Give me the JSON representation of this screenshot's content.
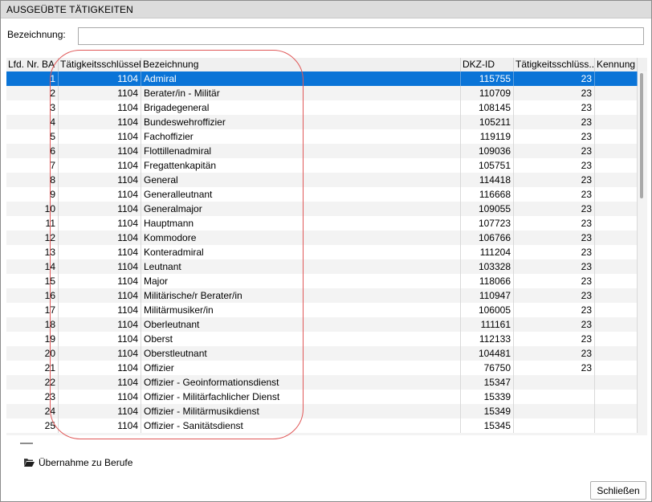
{
  "window": {
    "title": "AUSGEÜBTE TÄTIGKEITEN"
  },
  "filter": {
    "label": "Bezeichnung:",
    "value": "",
    "placeholder": ""
  },
  "table": {
    "columns": [
      "Lfd. Nr. BA",
      "Tätigkeitsschlüssel",
      "Bezeichnung",
      "DKZ-ID",
      "Tätigkeitsschlüss...",
      "Kennung"
    ],
    "selected_row": 0,
    "rows": [
      {
        "nr": "1",
        "key": "1104",
        "name": "Admiral",
        "dkz": "115755",
        "key2": "23",
        "id": ""
      },
      {
        "nr": "2",
        "key": "1104",
        "name": "Berater/in - Militär",
        "dkz": "110709",
        "key2": "23",
        "id": ""
      },
      {
        "nr": "3",
        "key": "1104",
        "name": "Brigadegeneral",
        "dkz": "108145",
        "key2": "23",
        "id": ""
      },
      {
        "nr": "4",
        "key": "1104",
        "name": "Bundeswehroffizier",
        "dkz": "105211",
        "key2": "23",
        "id": ""
      },
      {
        "nr": "5",
        "key": "1104",
        "name": "Fachoffizier",
        "dkz": "119119",
        "key2": "23",
        "id": ""
      },
      {
        "nr": "6",
        "key": "1104",
        "name": "Flottillenadmiral",
        "dkz": "109036",
        "key2": "23",
        "id": ""
      },
      {
        "nr": "7",
        "key": "1104",
        "name": "Fregattenkapitän",
        "dkz": "105751",
        "key2": "23",
        "id": ""
      },
      {
        "nr": "8",
        "key": "1104",
        "name": "General",
        "dkz": "114418",
        "key2": "23",
        "id": ""
      },
      {
        "nr": "9",
        "key": "1104",
        "name": "Generalleutnant",
        "dkz": "116668",
        "key2": "23",
        "id": ""
      },
      {
        "nr": "10",
        "key": "1104",
        "name": "Generalmajor",
        "dkz": "109055",
        "key2": "23",
        "id": ""
      },
      {
        "nr": "11",
        "key": "1104",
        "name": "Hauptmann",
        "dkz": "107723",
        "key2": "23",
        "id": ""
      },
      {
        "nr": "12",
        "key": "1104",
        "name": "Kommodore",
        "dkz": "106766",
        "key2": "23",
        "id": ""
      },
      {
        "nr": "13",
        "key": "1104",
        "name": "Konteradmiral",
        "dkz": "111204",
        "key2": "23",
        "id": ""
      },
      {
        "nr": "14",
        "key": "1104",
        "name": "Leutnant",
        "dkz": "103328",
        "key2": "23",
        "id": ""
      },
      {
        "nr": "15",
        "key": "1104",
        "name": "Major",
        "dkz": "118066",
        "key2": "23",
        "id": ""
      },
      {
        "nr": "16",
        "key": "1104",
        "name": "Militärische/r Berater/in",
        "dkz": "110947",
        "key2": "23",
        "id": ""
      },
      {
        "nr": "17",
        "key": "1104",
        "name": "Militärmusiker/in",
        "dkz": "106005",
        "key2": "23",
        "id": ""
      },
      {
        "nr": "18",
        "key": "1104",
        "name": "Oberleutnant",
        "dkz": "111161",
        "key2": "23",
        "id": ""
      },
      {
        "nr": "19",
        "key": "1104",
        "name": "Oberst",
        "dkz": "112133",
        "key2": "23",
        "id": ""
      },
      {
        "nr": "20",
        "key": "1104",
        "name": "Oberstleutnant",
        "dkz": "104481",
        "key2": "23",
        "id": ""
      },
      {
        "nr": "21",
        "key": "1104",
        "name": "Offizier",
        "dkz": "76750",
        "key2": "23",
        "id": ""
      },
      {
        "nr": "22",
        "key": "1104",
        "name": "Offizier - Geoinformationsdienst",
        "dkz": "15347",
        "key2": "",
        "id": ""
      },
      {
        "nr": "23",
        "key": "1104",
        "name": "Offizier - Militärfachlicher Dienst",
        "dkz": "15339",
        "key2": "",
        "id": ""
      },
      {
        "nr": "24",
        "key": "1104",
        "name": "Offizier - Militärmusikdienst",
        "dkz": "15349",
        "key2": "",
        "id": ""
      },
      {
        "nr": "25",
        "key": "1104",
        "name": "Offizier - Sanitätsdienst",
        "dkz": "15345",
        "key2": "",
        "id": ""
      }
    ]
  },
  "actions": {
    "transfer_label": "Übernahme zu Berufe",
    "transfer_icon": "folder-open-icon"
  },
  "buttons": {
    "close_label": "Schließen"
  },
  "colors": {
    "selection": "#0a74d7",
    "annotation": "#e05858",
    "titlebar": "#dcdcdc"
  }
}
